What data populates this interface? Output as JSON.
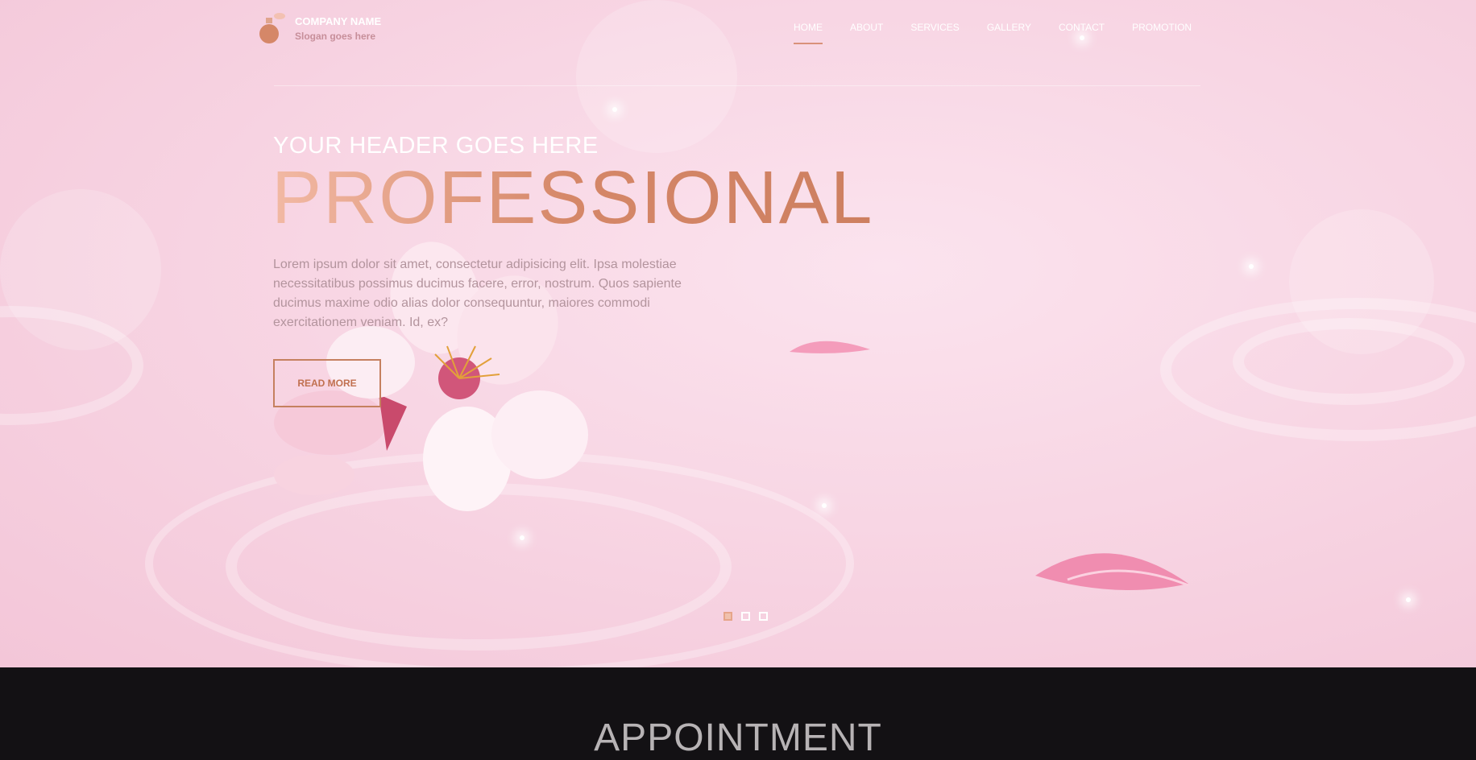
{
  "brand": {
    "name": "COMPANY NAME",
    "slogan": "Slogan goes here",
    "logo_icon": "perfume-bottle-icon"
  },
  "nav": {
    "items": [
      "HOME",
      "ABOUT",
      "SERVICES",
      "GALLERY",
      "CONTACT",
      "PROMOTION"
    ],
    "active": "HOME"
  },
  "hero": {
    "kicker": "YOUR HEADER GOES HERE",
    "title": "PROFESSIONAL",
    "body": "Lorem ipsum dolor sit amet, consectetur adipisicing elit. Ipsa molestiae necessitatibus possimus ducimus facere, error, nostrum. Quos sapiente ducimus maxime odio alias dolor consequuntur, maiores commodi exercitationem veniam. Id, ex?",
    "button_label": "READ MORE",
    "slides": {
      "count": 3,
      "active": 1
    }
  },
  "appointment": {
    "heading": "APPOINTMENT"
  },
  "colors": {
    "accent": "#d58768",
    "hero_bg": "#f8d6e4",
    "dark": "#131114"
  }
}
